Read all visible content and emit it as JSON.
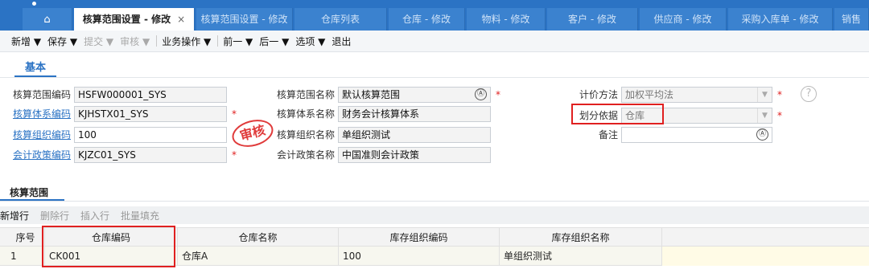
{
  "tabs": [
    {
      "label": "核算范围设置 - 修改",
      "close": "×",
      "active": true
    },
    {
      "label": "核算范围设置 - 修改"
    },
    {
      "label": "仓库列表"
    },
    {
      "label": "仓库 - 修改"
    },
    {
      "label": "物料 - 修改"
    },
    {
      "label": "客户 - 修改"
    },
    {
      "label": "供应商 - 修改"
    },
    {
      "label": "采购入库单 - 修改"
    },
    {
      "label": "销售"
    }
  ],
  "toolbar": [
    {
      "label": "新增 ▼",
      "disabled": false
    },
    {
      "label": "保存 ▼",
      "disabled": false
    },
    {
      "label": "提交 ▼",
      "disabled": true
    },
    {
      "label": "审核 ▼",
      "disabled": true
    },
    {
      "label": "业务操作 ▼",
      "disabled": false
    },
    {
      "label": "前一 ▼",
      "disabled": false
    },
    {
      "label": "后一 ▼",
      "disabled": false
    },
    {
      "label": "选项 ▼",
      "disabled": false
    },
    {
      "label": "退出",
      "disabled": false
    }
  ],
  "basic_tab": "基本",
  "form": {
    "scope_code_label": "核算范围编码",
    "scope_code_value": "HSFW000001_SYS",
    "system_code_label": "核算体系编码",
    "system_code_value": "KJHSTX01_SYS",
    "org_code_label": "核算组织编码",
    "org_code_value": "100",
    "policy_code_label": "会计政策编码",
    "policy_code_value": "KJZC01_SYS",
    "scope_name_label": "核算范围名称",
    "scope_name_value": "默认核算范围",
    "system_name_label": "核算体系名称",
    "system_name_value": "财务会计核算体系",
    "org_name_label": "核算组织名称",
    "org_name_value": "单组织测试",
    "policy_name_label": "会计政策名称",
    "policy_name_value": "中国准则会计政策",
    "pricing_label": "计价方法",
    "pricing_value": "加权平均法",
    "division_label": "划分依据",
    "division_value": "仓库",
    "remark_label": "备注",
    "remark_value": "",
    "required_mark": "*",
    "help_mark": "?",
    "chooser_mark": "Ⓐ",
    "dropdown_mark": "▼"
  },
  "stamp": "审核",
  "section_tab": "核算范围",
  "grid_toolbar": [
    {
      "label": "新增行",
      "disabled": false
    },
    {
      "label": "删除行",
      "disabled": true
    },
    {
      "label": "插入行",
      "disabled": true
    },
    {
      "label": "批量填充",
      "disabled": true
    }
  ],
  "grid": {
    "headers": [
      "序号",
      "仓库编码",
      "仓库名称",
      "库存组织编码",
      "库存组织名称"
    ],
    "rows": [
      [
        "1",
        "CK001",
        "仓库A",
        "100",
        "单组织测试"
      ]
    ]
  },
  "colors": {
    "accent": "#2b73c4",
    "highlight": "#e02020",
    "required": "#e02020"
  }
}
